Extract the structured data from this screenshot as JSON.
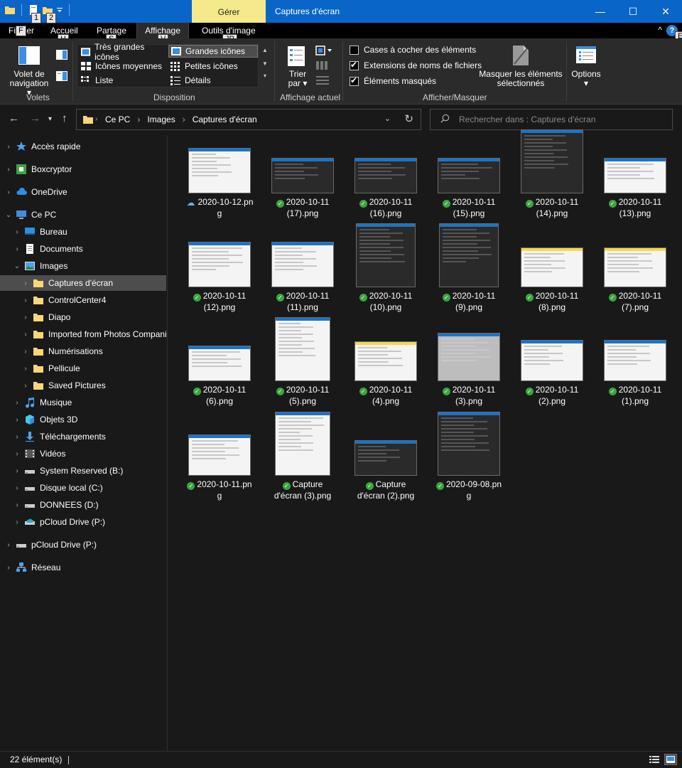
{
  "window": {
    "title": "Captures d'écran",
    "context_tab": "Gérer",
    "controls": [
      "—",
      "☐",
      "✕"
    ]
  },
  "keytips": [
    "1",
    "2",
    "F",
    "H",
    "S",
    "V",
    "JP",
    "E"
  ],
  "ribbon_tabs": {
    "fichier": "Fichier",
    "accueil": "Accueil",
    "partage": "Partage",
    "affichage": "Affichage",
    "outils": "Outils d'image",
    "collapse": "^",
    "help": "?"
  },
  "ribbon": {
    "volet_label": "Volet de",
    "volet_label2": "navigation",
    "group_volets": "Volets",
    "group_disposition": "Disposition",
    "group_affichage": "Affichage actuel",
    "group_afficher": "Afficher/Masquer",
    "layout": {
      "tres_grandes": "Très grandes icônes",
      "grandes": "Grandes icônes",
      "moyennes": "Icônes moyennes",
      "petites": "Petites icônes",
      "liste": "Liste",
      "details": "Détails"
    },
    "trier": "Trier",
    "trier2": "par",
    "checks": {
      "cases": "Cases à cocher des éléments",
      "extensions": "Extensions de noms de fichiers",
      "masques": "Éléments masqués"
    },
    "masquer": "Masquer les éléments",
    "masquer2": "sélectionnés",
    "options": "Options"
  },
  "address": {
    "crumbs": [
      "Ce PC",
      "Images",
      "Captures d'écran"
    ],
    "search_placeholder": "Rechercher dans : Captures d'écran"
  },
  "nav_tree": [
    {
      "label": "Accès rapide",
      "level": 0,
      "icon": "star-icon"
    },
    {
      "label": "Boxcryptor",
      "level": 0,
      "icon": "boxcryptor-icon"
    },
    {
      "label": "OneDrive",
      "level": 0,
      "icon": "cloud-icon"
    },
    {
      "label": "Ce PC",
      "level": 0,
      "icon": "computer-icon"
    },
    {
      "label": "Bureau",
      "level": 1,
      "icon": "desktop-icon"
    },
    {
      "label": "Documents",
      "level": 1,
      "icon": "documents-icon"
    },
    {
      "label": "Images",
      "level": 1,
      "icon": "pictures-icon"
    },
    {
      "label": "Captures d'écran",
      "level": 2,
      "icon": "folder-icon"
    },
    {
      "label": "ControlCenter4",
      "level": 2,
      "icon": "folder-icon"
    },
    {
      "label": "Diapo",
      "level": 2,
      "icon": "folder-icon"
    },
    {
      "label": "Imported from Photos Companion",
      "level": 2,
      "icon": "folder-icon"
    },
    {
      "label": "Numérisations",
      "level": 2,
      "icon": "folder-icon"
    },
    {
      "label": "Pellicule",
      "level": 2,
      "icon": "folder-icon"
    },
    {
      "label": "Saved Pictures",
      "level": 2,
      "icon": "folder-icon"
    },
    {
      "label": "Musique",
      "level": 1,
      "icon": "music-icon"
    },
    {
      "label": "Objets 3D",
      "level": 1,
      "icon": "cube-icon"
    },
    {
      "label": "Téléchargements",
      "level": 1,
      "icon": "download-icon"
    },
    {
      "label": "Vidéos",
      "level": 1,
      "icon": "video-icon"
    },
    {
      "label": "System Reserved (B:)",
      "level": 1,
      "icon": "drive-icon"
    },
    {
      "label": "Disque local (C:)",
      "level": 1,
      "icon": "drive-icon"
    },
    {
      "label": "DONNEES (D:)",
      "level": 1,
      "icon": "drive-icon"
    },
    {
      "label": "pCloud Drive (P:)",
      "level": 1,
      "icon": "cloud-drive-icon"
    },
    {
      "label": "pCloud Drive (P:)",
      "level": 0,
      "icon": "drive-icon"
    },
    {
      "label": "Réseau",
      "level": 0,
      "icon": "network-icon"
    }
  ],
  "files": [
    {
      "line1": "2020-10-12.pn",
      "line2": "g",
      "status": "cloud",
      "thumb": "light"
    },
    {
      "line1": "2020-10-11",
      "line2": "(17).png",
      "status": "synced",
      "thumb": "desktop"
    },
    {
      "line1": "2020-10-11",
      "line2": "(16).png",
      "status": "synced",
      "thumb": "desktop"
    },
    {
      "line1": "2020-10-11",
      "line2": "(15).png",
      "status": "synced",
      "thumb": "desktop"
    },
    {
      "line1": "2020-10-11",
      "line2": "(14).png",
      "status": "synced",
      "thumb": "darkapp"
    },
    {
      "line1": "2020-10-11",
      "line2": "(13).png",
      "status": "synced",
      "thumb": "dialog"
    },
    {
      "line1": "2020-10-11",
      "line2": "(12).png",
      "status": "synced",
      "thumb": "light"
    },
    {
      "line1": "2020-10-11",
      "line2": "(11).png",
      "status": "synced",
      "thumb": "light"
    },
    {
      "line1": "2020-10-11",
      "line2": "(10).png",
      "status": "synced",
      "thumb": "darkdialog"
    },
    {
      "line1": "2020-10-11",
      "line2": "(9).png",
      "status": "synced",
      "thumb": "darkdialog"
    },
    {
      "line1": "2020-10-11",
      "line2": "(8).png",
      "status": "synced",
      "thumb": "yellow"
    },
    {
      "line1": "2020-10-11",
      "line2": "(7).png",
      "status": "synced",
      "thumb": "yellow"
    },
    {
      "line1": "2020-10-11",
      "line2": "(6).png",
      "status": "synced",
      "thumb": "dialog"
    },
    {
      "line1": "2020-10-11",
      "line2": "(5).png",
      "status": "synced",
      "thumb": "doc"
    },
    {
      "line1": "2020-10-11",
      "line2": "(4).png",
      "status": "synced",
      "thumb": "yellow"
    },
    {
      "line1": "2020-10-11",
      "line2": "(3).png",
      "status": "synced",
      "thumb": "gray"
    },
    {
      "line1": "2020-10-11",
      "line2": "(2).png",
      "status": "synced",
      "thumb": "explorer"
    },
    {
      "line1": "2020-10-11",
      "line2": "(1).png",
      "status": "synced",
      "thumb": "explorer"
    },
    {
      "line1": "2020-10-11.pn",
      "line2": "g",
      "status": "synced",
      "thumb": "explorer"
    },
    {
      "line1": "Capture",
      "line2": "d'écran (3).png",
      "status": "synced",
      "thumb": "doc"
    },
    {
      "line1": "Capture",
      "line2": "d'écran (2).png",
      "status": "synced",
      "thumb": "desktop"
    },
    {
      "line1": "2020-09-08.pn",
      "line2": "g",
      "status": "synced",
      "thumb": "darkapp"
    }
  ],
  "status": {
    "count": "22 élément(s)"
  },
  "colors": {
    "titlebar": "#0a65c9",
    "gerer": "#f5ea8b",
    "background": "#191919",
    "ribbon": "#2b2b2b",
    "selection": "#4d4d4d",
    "sync_ok": "#3ea442"
  }
}
